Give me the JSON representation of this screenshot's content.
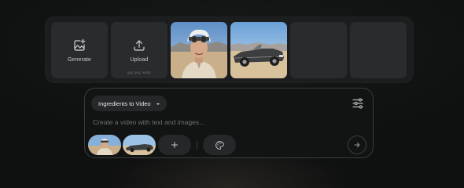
{
  "tray": {
    "generate": {
      "label": "Generate",
      "icon": "generate-image-icon"
    },
    "upload": {
      "label": "Upload",
      "sublabel": "jpg, png, webp",
      "icon": "upload-icon"
    },
    "assets": [
      {
        "name": "portrait-goggles-man",
        "kind": "image"
      },
      {
        "name": "convertible-car-desert",
        "kind": "image"
      }
    ],
    "empty_slots": 2
  },
  "composer": {
    "mode": {
      "label": "Ingredients to Video",
      "icon": "caret-down-icon"
    },
    "settings_icon": "sliders-icon",
    "prompt": {
      "value": "",
      "placeholder": "Create a video with text and images..."
    },
    "ingredients": [
      {
        "name": "portrait-goggles-man"
      },
      {
        "name": "convertible-car-desert"
      }
    ],
    "add_icon": "plus-icon",
    "style_icon": "palette-icon",
    "send_icon": "arrow-right-icon"
  },
  "colors": {
    "background": "#0f1010",
    "tray": "#1c1d1e",
    "tile": "#2a2b2c",
    "composer_border": "#3b3c3d",
    "pill": "#262728",
    "text": "#e8e8e8",
    "muted": "#6f7071"
  }
}
